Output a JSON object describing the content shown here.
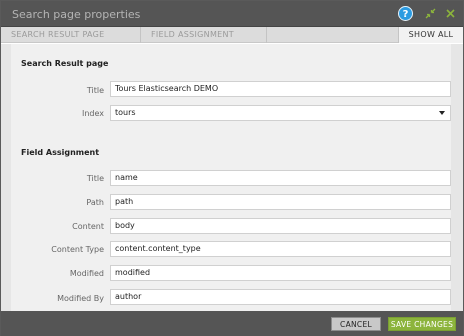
{
  "window": {
    "title": "Search page properties",
    "help_icon": "question-circle-icon",
    "shrink_icon": "shrink-arrows-icon",
    "close_icon": "close-icon",
    "help_glyph": "?"
  },
  "tabs": [
    {
      "label": "SEARCH RESULT PAGE"
    },
    {
      "label": "FIELD ASSIGNMENT"
    }
  ],
  "show_all_label": "SHOW ALL",
  "search_result_page": {
    "heading": "Search Result page",
    "title": {
      "label": "Title",
      "value": "Tours Elasticsearch DEMO"
    },
    "index": {
      "label": "Index",
      "value": "tours"
    }
  },
  "field_assignment": {
    "heading": "Field Assignment",
    "fields": [
      {
        "label": "Title",
        "value": "name"
      },
      {
        "label": "Path",
        "value": "path"
      },
      {
        "label": "Content",
        "value": "body"
      },
      {
        "label": "Content Type",
        "value": "content.content_type"
      },
      {
        "label": "Modified",
        "value": "modified"
      },
      {
        "label": "Modified By",
        "value": "author"
      }
    ]
  },
  "footer": {
    "cancel_label": "CANCEL",
    "save_label": "SAVE CHANGES"
  },
  "colors": {
    "titlebar": "#555555",
    "save_button": "#8cb43c",
    "help_icon": "#2c9be1"
  }
}
